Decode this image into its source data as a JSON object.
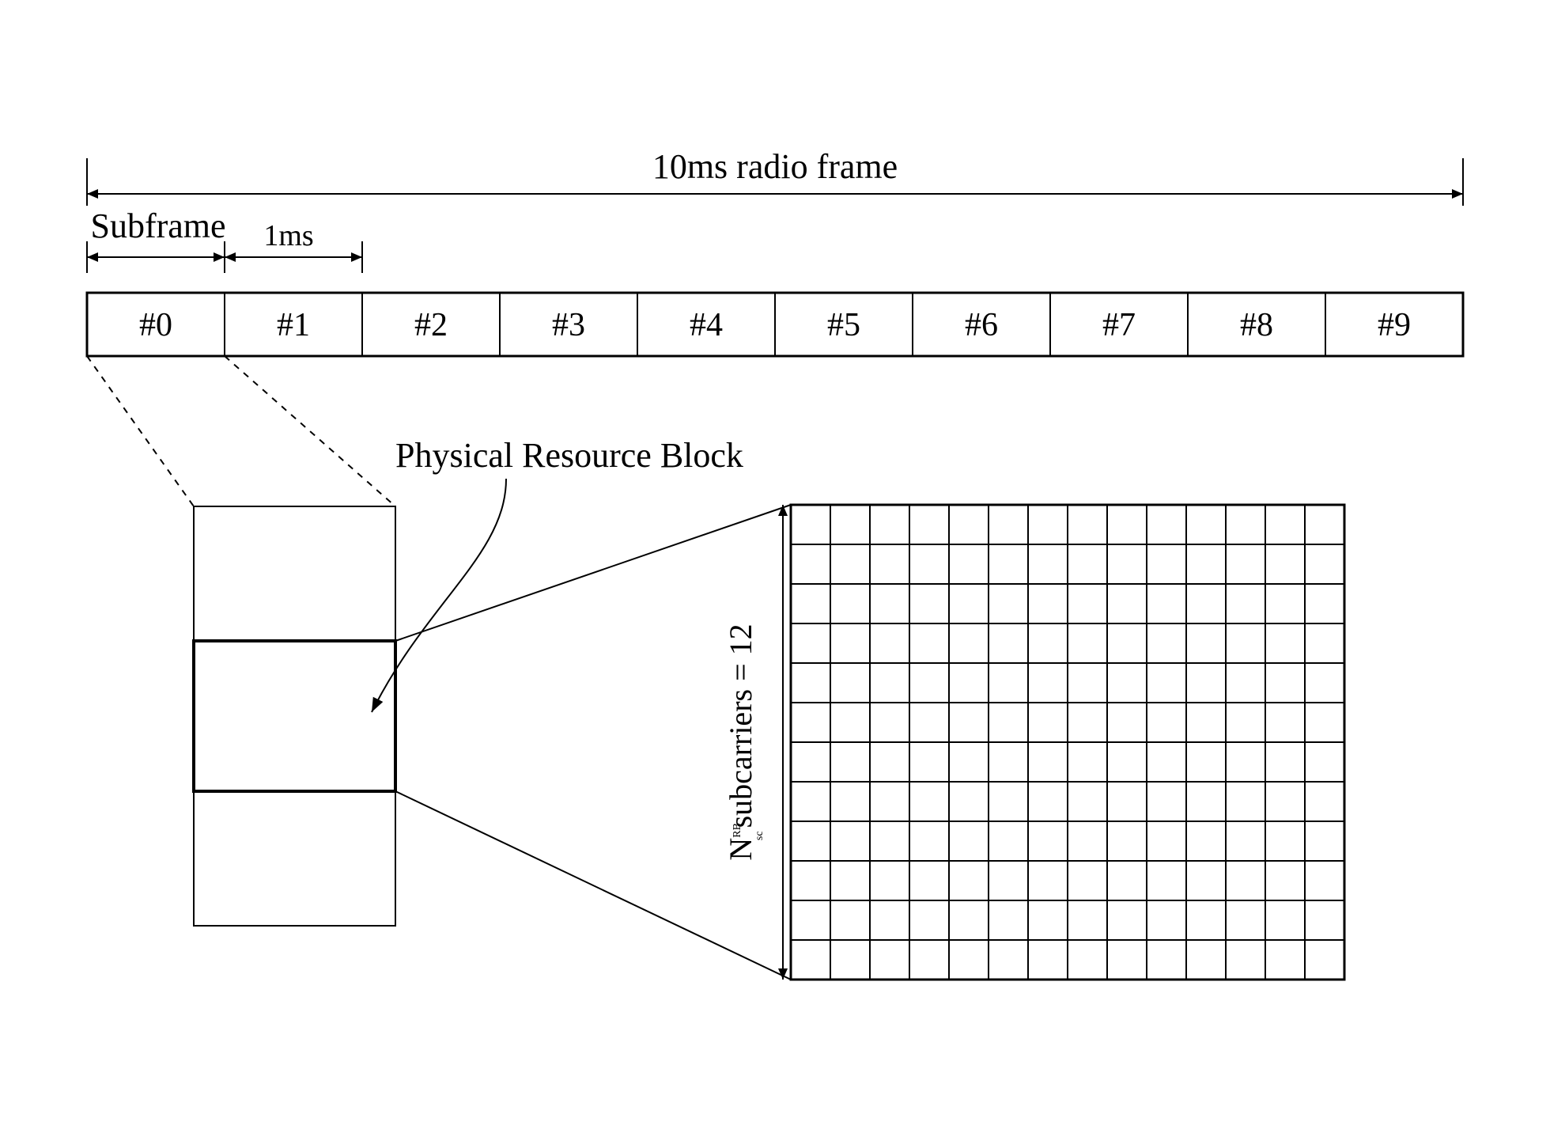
{
  "frame_label": "10ms radio frame",
  "subframe_label": "Subframe",
  "duration_label": "1ms",
  "subframes": [
    "#0",
    "#1",
    "#2",
    "#3",
    "#4",
    "#5",
    "#6",
    "#7",
    "#8",
    "#9"
  ],
  "prb_label": "Physical Resource Block",
  "subcarriers_label": {
    "prefix": "N",
    "sup": "RB",
    "sub": "sc",
    "suffix": "subcarriers = 12"
  },
  "chart_data": {
    "type": "table",
    "frame_ms": 10,
    "subframe_ms": 1,
    "subframe_count": 10,
    "prb_subcarriers": 12,
    "prb_symbols": 14
  }
}
